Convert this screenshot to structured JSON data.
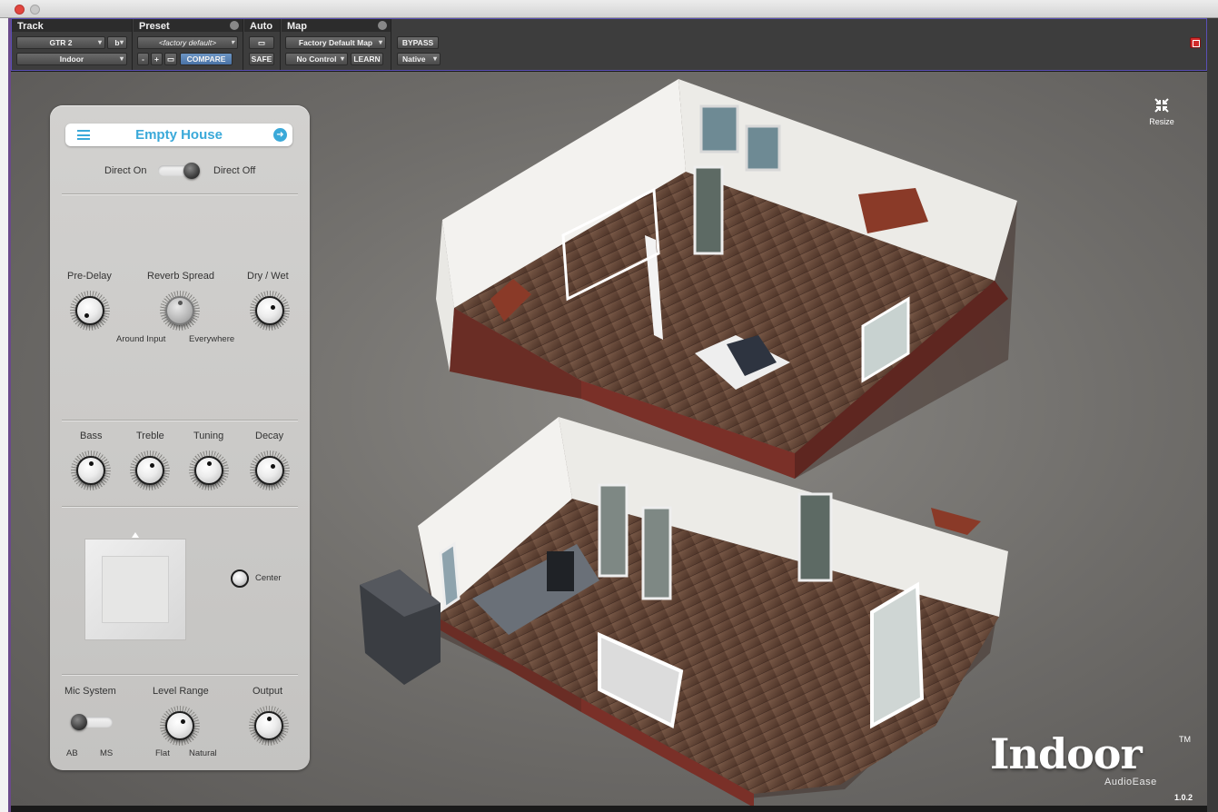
{
  "window": {
    "controls": [
      "close",
      "minimize"
    ]
  },
  "header": {
    "track_title": "Track",
    "track_name": "GTR 2",
    "track_channel": "b",
    "insert_name": "Indoor",
    "preset_title": "Preset",
    "preset_value": "<factory default>",
    "minus": "-",
    "plus": "+",
    "compare": "COMPARE",
    "auto_title": "Auto",
    "safe": "SAFE",
    "map_title": "Map",
    "map_value": "Factory Default Map",
    "control_value": "No Control",
    "learn": "LEARN",
    "bypass": "BYPASS",
    "native": "Native"
  },
  "plugin": {
    "preset_name": "Empty House",
    "direct_on": "Direct On",
    "direct_off": "Direct Off",
    "direct_state": "off",
    "pre_delay": "Pre-Delay",
    "reverb_spread": "Reverb Spread",
    "dry_wet": "Dry / Wet",
    "around_input": "Around Input",
    "everywhere": "Everywhere",
    "bass": "Bass",
    "treble": "Treble",
    "tuning": "Tuning",
    "decay": "Decay",
    "center": "Center",
    "mic_system": "Mic System",
    "level_range": "Level Range",
    "output": "Output",
    "ab": "AB",
    "ms": "MS",
    "flat": "Flat",
    "natural": "Natural",
    "resize": "Resize"
  },
  "branding": {
    "logo": "Indoor",
    "tm": "TM",
    "company": "AudioEase",
    "version": "1.0.2"
  },
  "colors": {
    "accent": "#3aa9d9",
    "compare": "#5a82b5",
    "bypass_close": "#d12b2b"
  }
}
